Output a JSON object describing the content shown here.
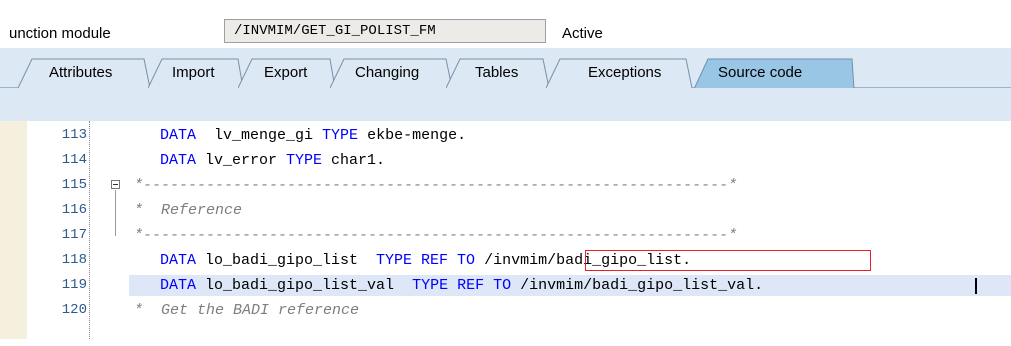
{
  "header": {
    "fm_label": "unction module",
    "fm_value": "/INVMIM/GET_GI_POLIST_FM",
    "status": "Active"
  },
  "tabs": [
    {
      "label": "Attributes",
      "active": false
    },
    {
      "label": "Import",
      "active": false
    },
    {
      "label": "Export",
      "active": false
    },
    {
      "label": "Changing",
      "active": false
    },
    {
      "label": "Tables",
      "active": false
    },
    {
      "label": "Exceptions",
      "active": false
    },
    {
      "label": "Source code",
      "active": true
    }
  ],
  "editor": {
    "lines": [
      {
        "num": "113",
        "parts": [
          [
            "kw",
            "DATA"
          ],
          [
            "",
            "  lv_menge_gi "
          ],
          [
            "kw",
            "TYPE"
          ],
          [
            "",
            " ekbe-menge."
          ]
        ]
      },
      {
        "num": "114",
        "parts": [
          [
            "kw",
            "DATA"
          ],
          [
            "",
            " lv_error "
          ],
          [
            "kw",
            "TYPE"
          ],
          [
            "",
            " char1."
          ]
        ]
      },
      {
        "num": "115",
        "parts": [
          [
            "cmt",
            "*-----------------------------------------------------------------*"
          ]
        ]
      },
      {
        "num": "116",
        "parts": [
          [
            "cmt",
            "*  Reference"
          ]
        ]
      },
      {
        "num": "117",
        "parts": [
          [
            "cmt",
            "*-----------------------------------------------------------------*"
          ]
        ]
      },
      {
        "num": "118",
        "parts": [
          [
            "kw",
            "DATA"
          ],
          [
            "",
            " lo_badi_gipo_list  "
          ],
          [
            "kw",
            "TYPE REF TO"
          ],
          [
            "",
            " /invmim/badi_gipo_list."
          ]
        ]
      },
      {
        "num": "119",
        "parts": [
          [
            "kw",
            "DATA"
          ],
          [
            "",
            " lo_badi_gipo_list_val  "
          ],
          [
            "kw",
            "TYPE REF TO"
          ],
          [
            "",
            " /invmim/badi_gipo_list_val."
          ]
        ]
      },
      {
        "num": "120",
        "parts": [
          [
            "cmt",
            "*  Get the BADI reference"
          ]
        ]
      }
    ]
  },
  "colors": {
    "keyword": "#0000ff",
    "comment": "#7f7f7f",
    "line_number": "#2d5a8a",
    "highlight_row": "#dde7f7",
    "annotation_box": "#e8202a"
  }
}
